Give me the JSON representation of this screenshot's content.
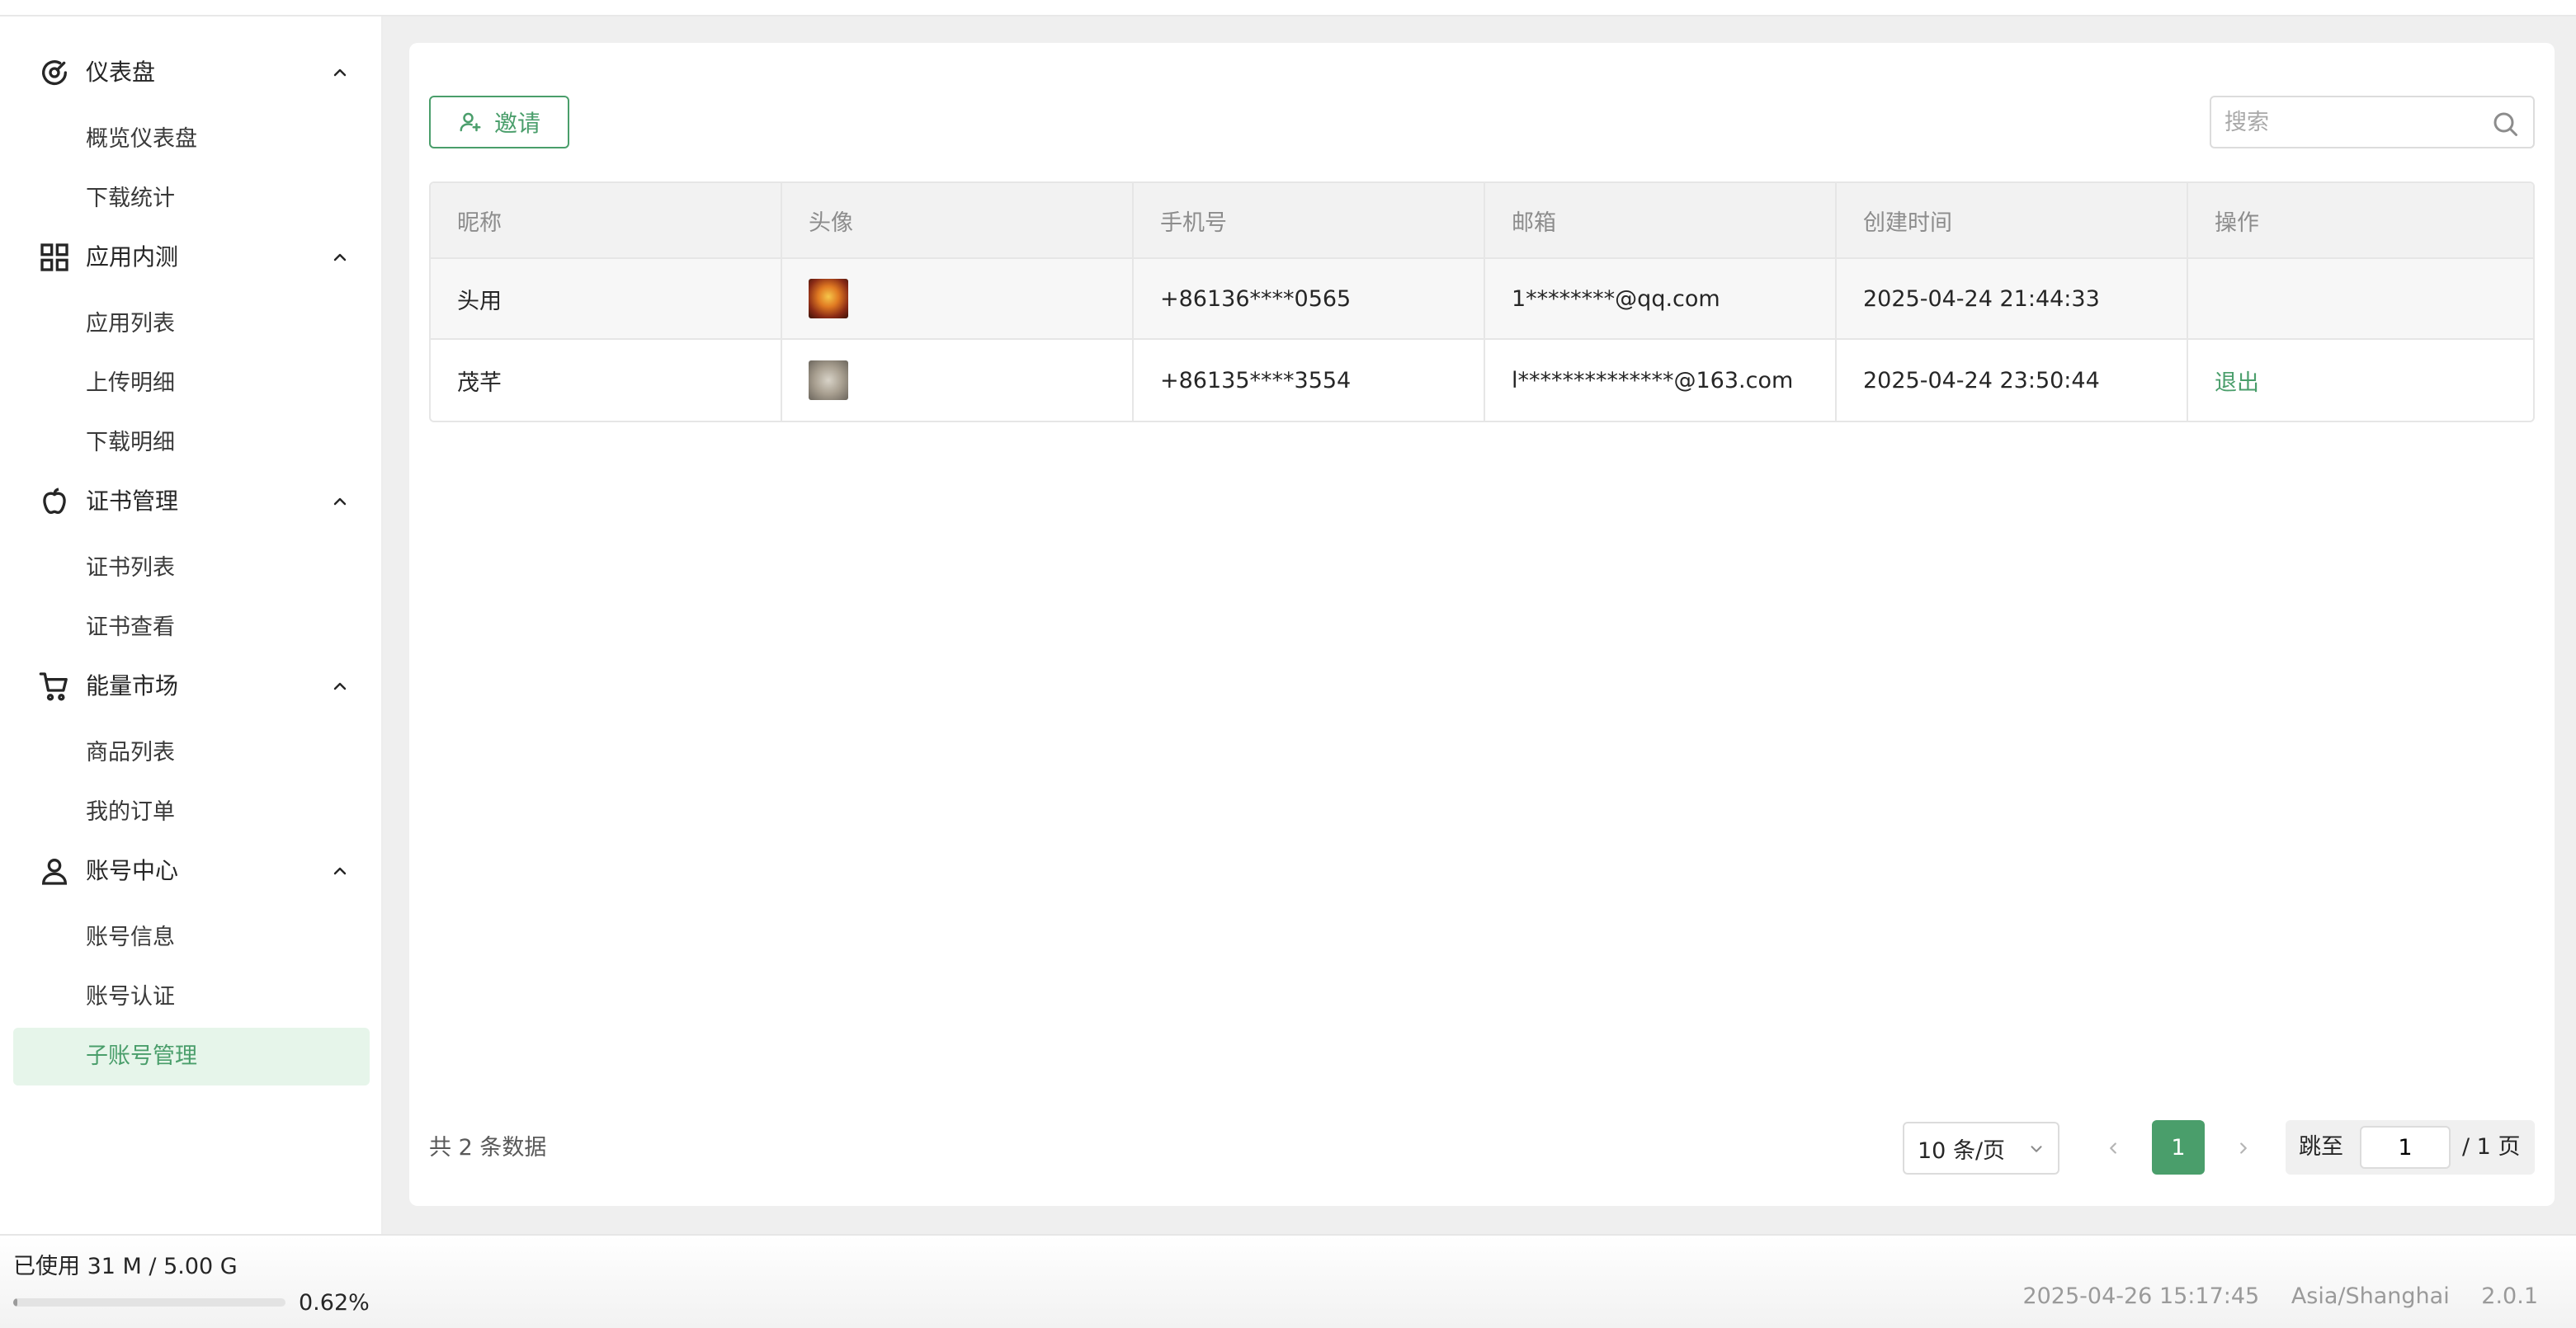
{
  "sidebar": {
    "groups": [
      {
        "label": "仪表盘",
        "items": [
          "概览仪表盘",
          "下载统计"
        ]
      },
      {
        "label": "应用内测",
        "items": [
          "应用列表",
          "上传明细",
          "下载明细"
        ]
      },
      {
        "label": "证书管理",
        "items": [
          "证书列表",
          "证书查看"
        ]
      },
      {
        "label": "能量市场",
        "items": [
          "商品列表",
          "我的订单"
        ]
      },
      {
        "label": "账号中心",
        "items": [
          "账号信息",
          "账号认证",
          "子账号管理"
        ]
      }
    ],
    "active_item": "子账号管理"
  },
  "toolbar": {
    "invite_label": "邀请",
    "search_placeholder": "搜索"
  },
  "table": {
    "columns": [
      "昵称",
      "头像",
      "手机号",
      "邮箱",
      "创建时间",
      "操作"
    ],
    "rows": [
      {
        "nickname": "头用",
        "phone": "+86136****0565",
        "email": "1********@qq.com",
        "created": "2025-04-24 21:44:33",
        "action": ""
      },
      {
        "nickname": "茂芊",
        "phone": "+86135****3554",
        "email": "l**************@163.com",
        "created": "2025-04-24 23:50:44",
        "action": "退出"
      }
    ]
  },
  "pagination": {
    "total_text": "共 2 条数据",
    "page_size": "10 条/页",
    "current_page": "1",
    "jump_label": "跳至",
    "jump_value": "1",
    "total_pages_text": "/ 1 页"
  },
  "footer": {
    "storage_text": "已使用 31 M / 5.00 G",
    "storage_percent": "0.62%",
    "storage_fraction": 0.0062,
    "datetime": "2025-04-26 15:17:45",
    "timezone": "Asia/Shanghai",
    "version": "2.0.1"
  },
  "colors": {
    "accent": "#4a9e6b",
    "active_bg": "#e6f5ea"
  }
}
